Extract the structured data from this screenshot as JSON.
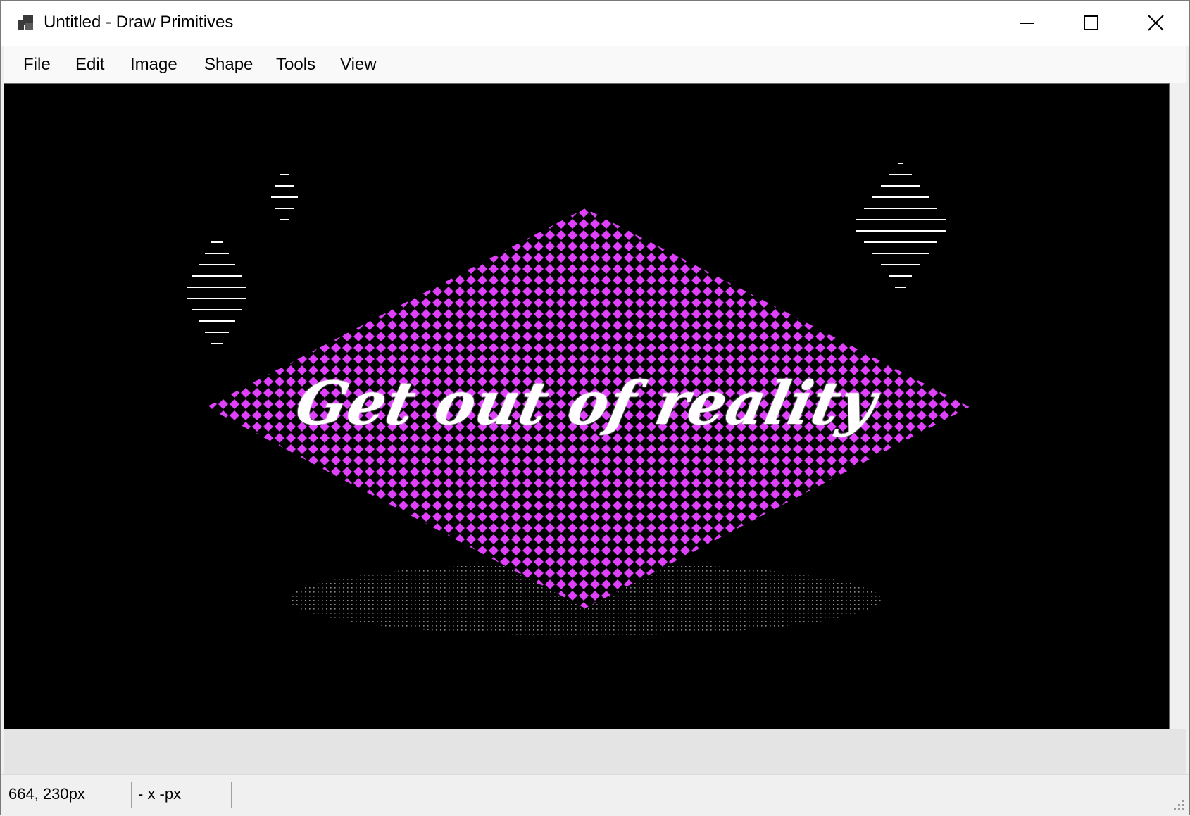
{
  "window": {
    "title": "Untitled - Draw Primitives",
    "app_icon": "draw-primitives-app-icon",
    "controls": [
      "minimize-icon",
      "maximize-icon",
      "close-icon"
    ]
  },
  "menubar": {
    "items": [
      {
        "label": "File"
      },
      {
        "label": "Edit"
      },
      {
        "label": "Image"
      },
      {
        "label": "Shape"
      },
      {
        "label": "Tools"
      },
      {
        "label": "View"
      }
    ]
  },
  "canvas": {
    "background": "#000000",
    "text": "Get out of reality",
    "text_color": "#ffffff",
    "diamond_fill_color": "#e040fb",
    "stripe_color": "#ffffff",
    "shadow_dot_color": "#8a8a8a"
  },
  "statusbar": {
    "cursor_position": "664, 230px",
    "selection_size": "- x -px"
  }
}
